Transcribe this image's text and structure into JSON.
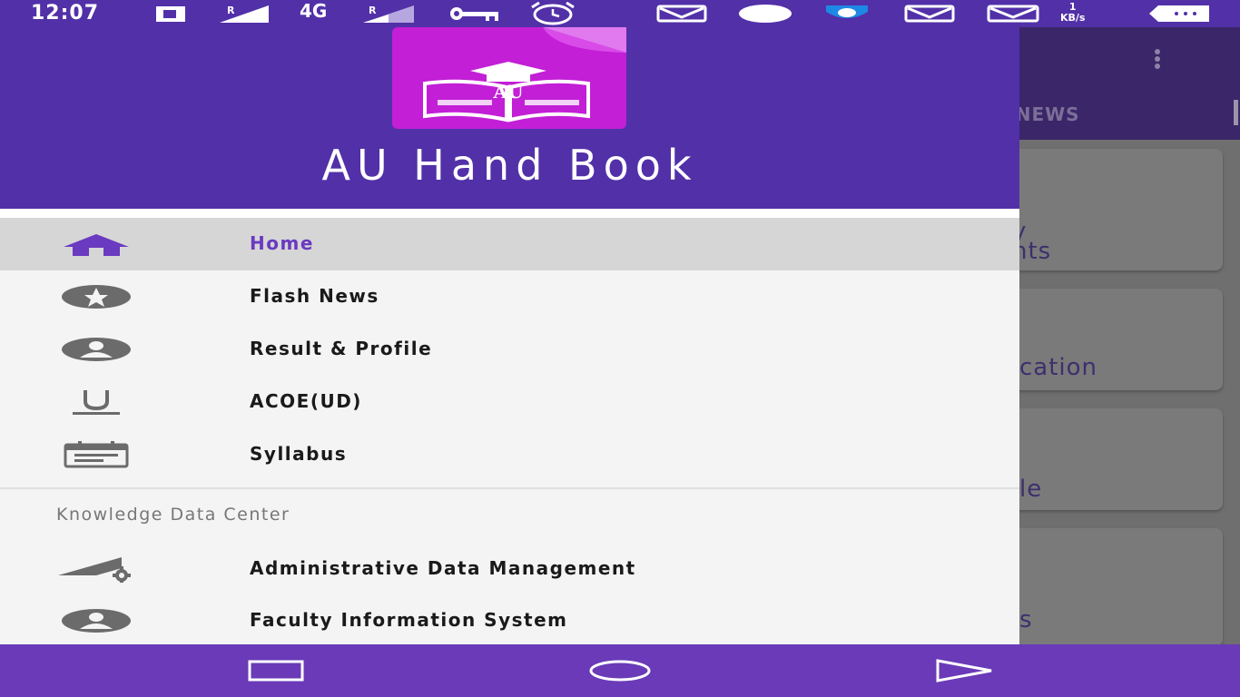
{
  "status_bar": {
    "time": "12:07",
    "network": "4G",
    "speed_value": "1",
    "speed_unit": "KB/s",
    "icons": [
      "signal-icon",
      "key-icon",
      "alarm-icon",
      "gmail-icon",
      "shield-icon",
      "battery-icon"
    ]
  },
  "drawer": {
    "app_title": "AU Hand Book",
    "logo_letters": "AU",
    "items": [
      {
        "label": "Home",
        "icon": "home-icon",
        "active": true
      },
      {
        "label": "Flash News",
        "icon": "star-icon"
      },
      {
        "label": "Result & Profile",
        "icon": "account-icon"
      },
      {
        "label": "ACOE(UD)",
        "icon": "underline-u-icon"
      },
      {
        "label": "Syllabus",
        "icon": "calendar-note-icon"
      }
    ],
    "section_title": "Knowledge Data Center",
    "section_items": [
      {
        "label": "Administrative Data Management",
        "icon": "signal-gear-icon"
      },
      {
        "label": "Faculty Information System",
        "icon": "account-icon"
      }
    ]
  },
  "background_app": {
    "tab_label": "H NEWS",
    "cards": [
      "y",
      "nts",
      "cation",
      "le",
      "s"
    ]
  },
  "colors": {
    "primary": "#5230a8",
    "accent": "#6a3ac0",
    "navbar": "#6a3ab8"
  }
}
